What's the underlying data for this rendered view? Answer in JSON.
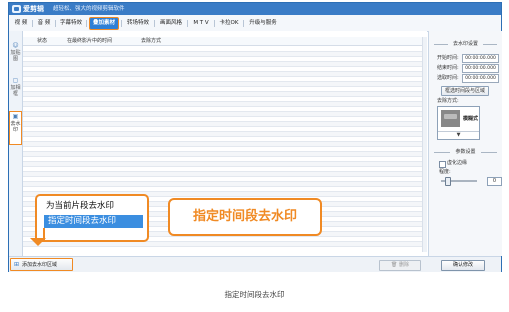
{
  "app": {
    "name": "爱剪辑",
    "slogan": "超轻松、强大的视频剪辑软件"
  },
  "menu": {
    "tabs": [
      {
        "label": "视 频"
      },
      {
        "label": "音 频"
      },
      {
        "label": "字幕特效"
      },
      {
        "label": "叠加素材"
      },
      {
        "label": "转场特效"
      },
      {
        "label": "画面风格"
      },
      {
        "label": "M T V"
      },
      {
        "label": "卡拉OK"
      },
      {
        "label": "升级与服务"
      }
    ],
    "active_index": 3
  },
  "sidebar": {
    "tabs": [
      {
        "label": "加贴图",
        "icon": "sticker-icon"
      },
      {
        "label": "加相框",
        "icon": "frame-icon"
      },
      {
        "label": "去水印",
        "icon": "watermark-icon"
      }
    ],
    "active_index": 2
  },
  "list": {
    "columns": [
      "状态",
      "在最终影片中的时间",
      "去除方式"
    ]
  },
  "settings": {
    "title": "去水印设置",
    "start_label": "开始时间:",
    "start_value": "00:00:00.000",
    "end_label": "结束时间:",
    "end_value": "00:00:00.000",
    "area_label": "选取时间:",
    "area_value": "00:00:00.000",
    "pick_button": "框选时间段与区域",
    "method_label": "去除方式:",
    "method_value": "模糊式",
    "method_dropdown": "▼"
  },
  "params": {
    "title": "参数设置",
    "checkbox_label": "虚化边缘",
    "degree_label": "程度:",
    "degree_value": "0"
  },
  "bottom": {
    "add_button": "添加去水印区域",
    "delete_button": "删除",
    "ok_button": "确认修改"
  },
  "popup": {
    "item1": "为当前片段去水印",
    "item2": "指定时间段去水印"
  },
  "callout": "指定时间段去水印",
  "caption": "指定时间段去水印",
  "colors": {
    "accent": "#f08a24",
    "brand": "#3a7cc6",
    "highlight": "#3b8ee0"
  }
}
